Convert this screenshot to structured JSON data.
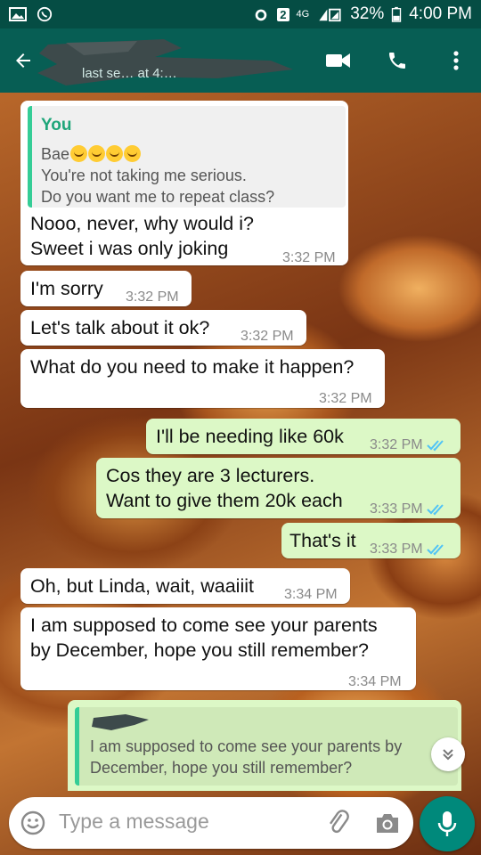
{
  "status_bar": {
    "sim_badge": "2",
    "network": "4G",
    "battery": "32%",
    "time": "4:00 PM"
  },
  "toolbar": {
    "last_seen": "last se…          at 4:…",
    "icons": [
      "back-arrow-icon",
      "video-call-icon",
      "voice-call-icon",
      "more-vert-icon"
    ]
  },
  "colors": {
    "header": "#075e54",
    "status_bar": "#054d44",
    "incoming_bubble": "#ffffff",
    "outgoing_bubble": "#dcf8c6",
    "read_tick": "#4fc3f7",
    "accent": "#00897b"
  },
  "messages": [
    {
      "direction": "in",
      "quote": {
        "author": "You",
        "line1": "Bae",
        "line2": "You're not taking me serious.",
        "line3": "Do you want me to repeat class?"
      },
      "line1": "Nooo, never, why would i?",
      "line2": "Sweet i was only joking",
      "time": "3:32 PM"
    },
    {
      "direction": "in",
      "line1": "I'm sorry",
      "time": "3:32 PM"
    },
    {
      "direction": "in",
      "line1": "Let's talk about it ok?",
      "time": "3:32 PM"
    },
    {
      "direction": "in",
      "line1": "What do you need to make it happen?",
      "time": "3:32 PM"
    },
    {
      "direction": "out",
      "line1": "I'll  be needing like 60k",
      "time": "3:32 PM",
      "status": "read"
    },
    {
      "direction": "out",
      "line1": "Cos they are 3 lecturers.",
      "line2": "Want to give them 20k each",
      "time": "3:33 PM",
      "status": "read"
    },
    {
      "direction": "out",
      "line1": "That's it",
      "time": "3:33 PM",
      "status": "read"
    },
    {
      "direction": "in",
      "line1": "Oh, but Linda, wait, waaiiit",
      "time": "3:34 PM"
    },
    {
      "direction": "in",
      "line1": "I am supposed to come see your parents",
      "line2": "by December, hope you still remember?",
      "time": "3:34 PM"
    }
  ],
  "reply_preview": {
    "line1": "I am supposed to come see your parents by",
    "line2": "December, hope you still remember?"
  },
  "composer": {
    "placeholder": "Type a message"
  }
}
